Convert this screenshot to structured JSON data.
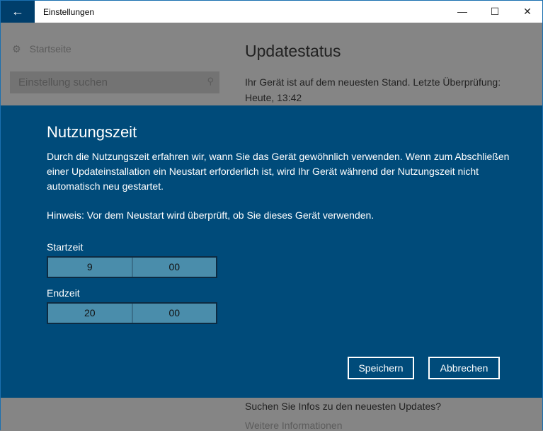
{
  "window": {
    "title": "Einstellungen"
  },
  "sidebar": {
    "home_label": "Startseite",
    "search_placeholder": "Einstellung suchen"
  },
  "main": {
    "heading": "Updatestatus",
    "status": "Ihr Gerät ist auf dem neuesten Stand. Letzte Überprüfung: Heute, 13:42",
    "info_question": "Suchen Sie Infos zu den neuesten Updates?",
    "more_link": "Weitere Informationen"
  },
  "dialog": {
    "title": "Nutzungszeit",
    "description": "Durch die Nutzungszeit erfahren wir, wann Sie das Gerät gewöhnlich verwenden. Wenn zum Abschließen einer Updateinstallation ein Neustart erforderlich ist, wird Ihr Gerät während der Nutzungszeit nicht automatisch neu gestartet.",
    "hint": "Hinweis: Vor dem Neustart wird überprüft, ob Sie dieses Gerät verwenden.",
    "start": {
      "label": "Startzeit",
      "hour": "9",
      "minute": "00"
    },
    "end": {
      "label": "Endzeit",
      "hour": "20",
      "minute": "00"
    },
    "save_label": "Speichern",
    "cancel_label": "Abbrechen"
  }
}
